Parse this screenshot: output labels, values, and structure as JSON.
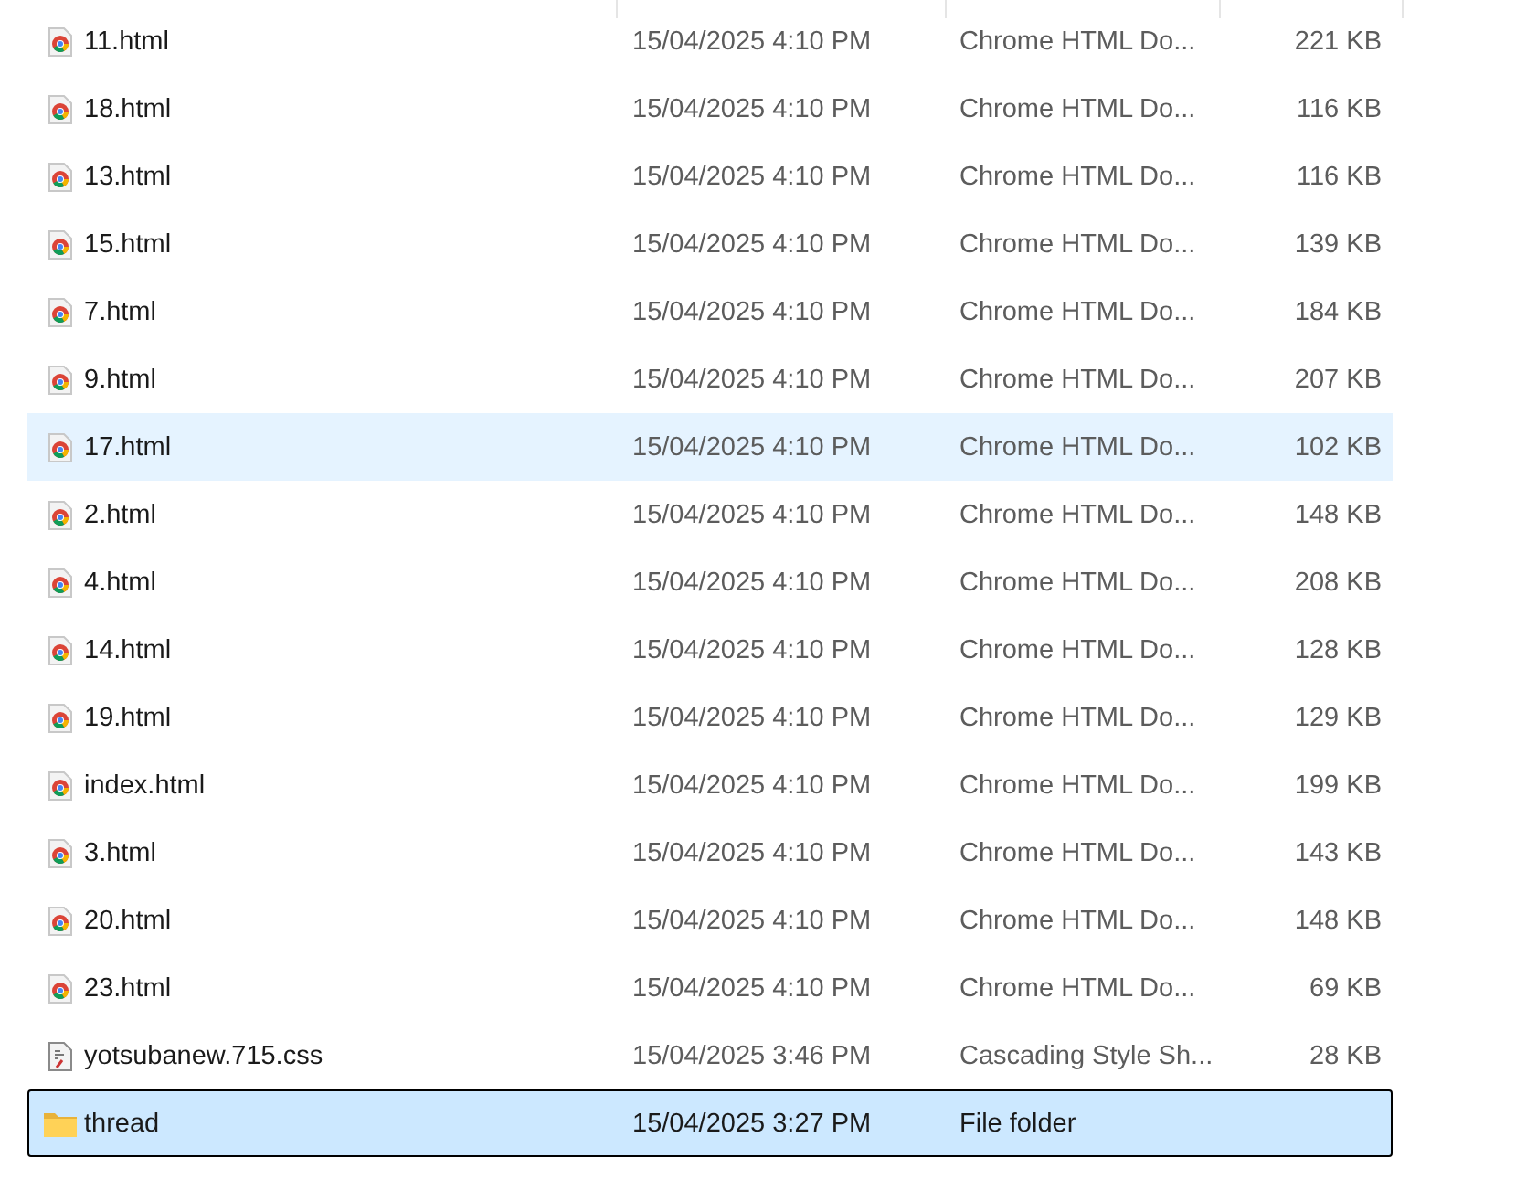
{
  "files": [
    {
      "name": "11.html",
      "date": "15/04/2025 4:10 PM",
      "type": "Chrome HTML Do...",
      "size": "221 KB",
      "kind": "html",
      "hovered": false,
      "selected": false
    },
    {
      "name": "18.html",
      "date": "15/04/2025 4:10 PM",
      "type": "Chrome HTML Do...",
      "size": "116 KB",
      "kind": "html",
      "hovered": false,
      "selected": false
    },
    {
      "name": "13.html",
      "date": "15/04/2025 4:10 PM",
      "type": "Chrome HTML Do...",
      "size": "116 KB",
      "kind": "html",
      "hovered": false,
      "selected": false
    },
    {
      "name": "15.html",
      "date": "15/04/2025 4:10 PM",
      "type": "Chrome HTML Do...",
      "size": "139 KB",
      "kind": "html",
      "hovered": false,
      "selected": false
    },
    {
      "name": "7.html",
      "date": "15/04/2025 4:10 PM",
      "type": "Chrome HTML Do...",
      "size": "184 KB",
      "kind": "html",
      "hovered": false,
      "selected": false
    },
    {
      "name": "9.html",
      "date": "15/04/2025 4:10 PM",
      "type": "Chrome HTML Do...",
      "size": "207 KB",
      "kind": "html",
      "hovered": false,
      "selected": false
    },
    {
      "name": "17.html",
      "date": "15/04/2025 4:10 PM",
      "type": "Chrome HTML Do...",
      "size": "102 KB",
      "kind": "html",
      "hovered": true,
      "selected": false
    },
    {
      "name": "2.html",
      "date": "15/04/2025 4:10 PM",
      "type": "Chrome HTML Do...",
      "size": "148 KB",
      "kind": "html",
      "hovered": false,
      "selected": false
    },
    {
      "name": "4.html",
      "date": "15/04/2025 4:10 PM",
      "type": "Chrome HTML Do...",
      "size": "208 KB",
      "kind": "html",
      "hovered": false,
      "selected": false
    },
    {
      "name": "14.html",
      "date": "15/04/2025 4:10 PM",
      "type": "Chrome HTML Do...",
      "size": "128 KB",
      "kind": "html",
      "hovered": false,
      "selected": false
    },
    {
      "name": "19.html",
      "date": "15/04/2025 4:10 PM",
      "type": "Chrome HTML Do...",
      "size": "129 KB",
      "kind": "html",
      "hovered": false,
      "selected": false
    },
    {
      "name": "index.html",
      "date": "15/04/2025 4:10 PM",
      "type": "Chrome HTML Do...",
      "size": "199 KB",
      "kind": "html",
      "hovered": false,
      "selected": false
    },
    {
      "name": "3.html",
      "date": "15/04/2025 4:10 PM",
      "type": "Chrome HTML Do...",
      "size": "143 KB",
      "kind": "html",
      "hovered": false,
      "selected": false
    },
    {
      "name": "20.html",
      "date": "15/04/2025 4:10 PM",
      "type": "Chrome HTML Do...",
      "size": "148 KB",
      "kind": "html",
      "hovered": false,
      "selected": false
    },
    {
      "name": "23.html",
      "date": "15/04/2025 4:10 PM",
      "type": "Chrome HTML Do...",
      "size": "69 KB",
      "kind": "html",
      "hovered": false,
      "selected": false
    },
    {
      "name": "yotsubanew.715.css",
      "date": "15/04/2025 3:46 PM",
      "type": "Cascading Style Sh...",
      "size": "28 KB",
      "kind": "css",
      "hovered": false,
      "selected": false
    },
    {
      "name": "thread",
      "date": "15/04/2025 3:27 PM",
      "type": "File folder",
      "kind": "folder",
      "hovered": false,
      "selected": true
    }
  ]
}
